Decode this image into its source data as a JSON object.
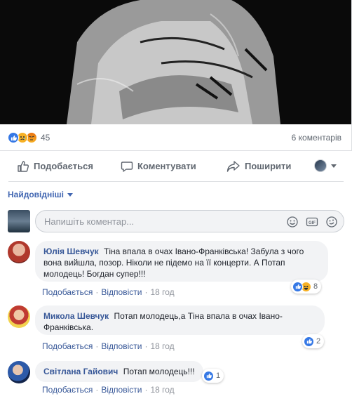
{
  "post": {
    "reactions_count": "45",
    "reaction_icons": [
      "like-icon",
      "sad-icon",
      "angry-icon"
    ],
    "comments_count": "6 коментарів"
  },
  "actions": {
    "like": "Подобається",
    "comment": "Коментувати",
    "share": "Поширити"
  },
  "sort_label": "Найдовідніші",
  "composer": {
    "placeholder": "Напишіть коментар..."
  },
  "comments": [
    {
      "author": "Юлія Шевчук",
      "text": "Тіна впала в очах Івано-Франківська! Забула з чого вона вийшла, позор. Ніколи не підемо на її концерти. А Потап молодець! Богдан супер!!!",
      "like": "Подобається",
      "reply": "Відповісти",
      "time": "18 год",
      "reaction_count": "8",
      "reaction_icons": [
        "like-icon",
        "haha-icon"
      ]
    },
    {
      "author": "Микола Шевчук",
      "text": "Потап молодець,а Тіна впала в очах Івано-Франківська.",
      "like": "Подобається",
      "reply": "Відповісти",
      "time": "18 год",
      "reaction_count": "2",
      "reaction_icons": [
        "like-icon"
      ]
    },
    {
      "author": "Світлана Гайович",
      "text": "Потап молодець!!!",
      "like": "Подобається",
      "reply": "Відповісти",
      "time": "18 год",
      "reaction_count": "1",
      "reaction_icons": [
        "like-icon"
      ]
    }
  ],
  "colors": {
    "link": "#385898",
    "like_blue": "#3578e5",
    "bubble": "#f2f3f5",
    "meta_gray": "#90949c"
  }
}
